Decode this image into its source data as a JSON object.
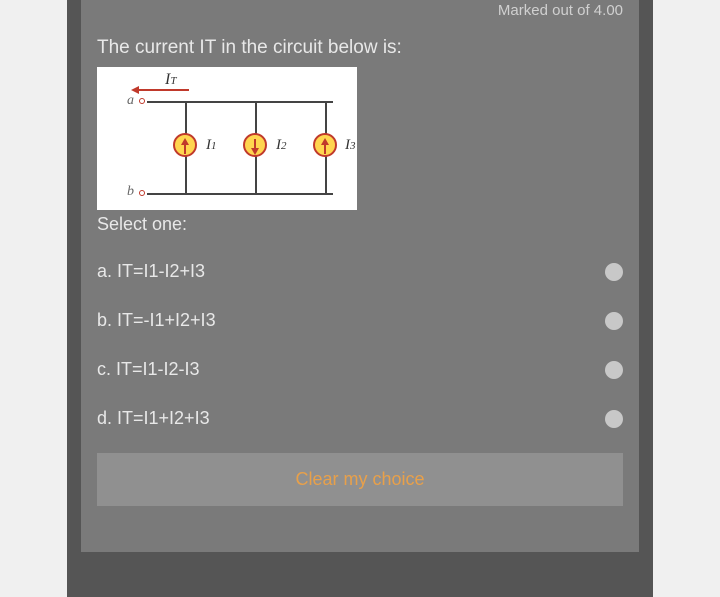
{
  "header": {
    "marks": "Marked out of 4.00"
  },
  "question": {
    "text": "The current IT in the circuit below is:",
    "select_label": "Select one:"
  },
  "circuit": {
    "it_label": "I",
    "it_sub": "T",
    "node_a": "a",
    "node_b": "b",
    "sources": [
      {
        "label": "I",
        "sub": "1",
        "direction": "up"
      },
      {
        "label": "I",
        "sub": "2",
        "direction": "down"
      },
      {
        "label": "I",
        "sub": "3",
        "direction": "up"
      }
    ]
  },
  "options": [
    {
      "label": "a. IT=I1-I2+I3"
    },
    {
      "label": "b. IT=-I1+I2+I3"
    },
    {
      "label": "c. IT=I1-I2-I3"
    },
    {
      "label": "d. IT=I1+I2+I3"
    }
  ],
  "clear_label": "Clear my choice"
}
